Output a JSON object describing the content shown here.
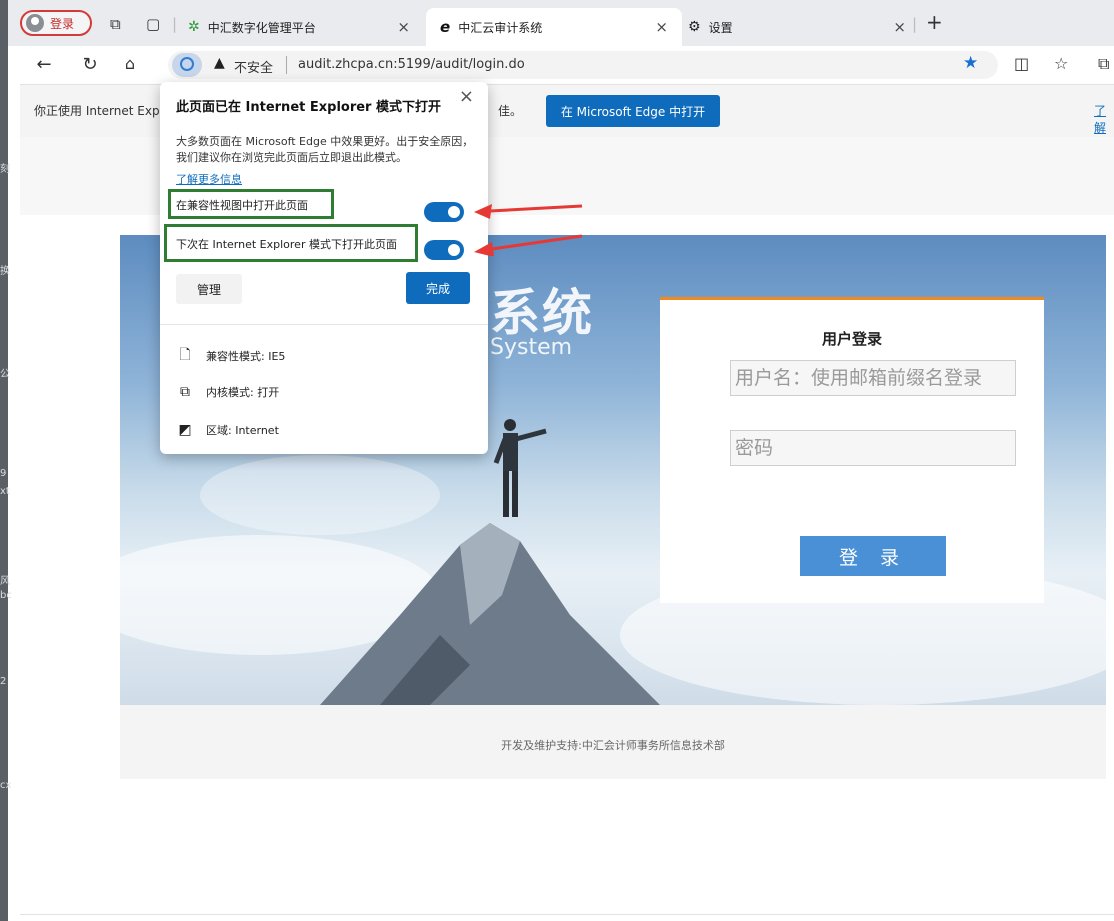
{
  "left_strip_chars": [
    "刻",
    "换",
    "公",
    "9",
    "xt",
    "风",
    "bc",
    "2",
    "cx"
  ],
  "profile": {
    "label": "登录"
  },
  "tabs": [
    {
      "title": "中汇数字化管理平台",
      "icon": "gear-app-icon"
    },
    {
      "title": "中汇云审计系统",
      "icon": "ie-logo-icon",
      "active": true
    },
    {
      "title": "设置",
      "icon": "settings-gear-icon"
    }
  ],
  "tab_close": "×",
  "new_tab": "+",
  "address": {
    "security": "不安全",
    "url": "audit.zhcpa.cn:5199/audit/login.do"
  },
  "infobar": {
    "text": "你正使用 Internet Exp",
    "suffix": "佳。",
    "open_button": "在 Microsoft Edge 中打开",
    "learn_more": "了解"
  },
  "popup": {
    "title": "此页面已在 Internet Explorer 模式下打开",
    "close": "×",
    "description": "大多数页面在 Microsoft Edge 中效果更好。出于安全原因，我们建议你在浏览完此页面后立即退出此模式。",
    "link": "了解更多信息",
    "toggle1_label": "在兼容性视图中打开此页面",
    "toggle2_label": "下次在 Internet Explorer 模式下打开此页面",
    "manage": "管理",
    "done": "完成",
    "info_rows": [
      {
        "icon": "document-icon",
        "text": "兼容性模式: IE5"
      },
      {
        "icon": "engine-icon",
        "text": "内核模式: 打开"
      },
      {
        "icon": "zone-icon",
        "text": "区域: Internet"
      }
    ]
  },
  "hero": {
    "title": "系统",
    "subtitle": "System"
  },
  "login": {
    "title": "用户登录",
    "username_placeholder": "用户名：使用邮箱前缀名登录",
    "password_placeholder": "密码",
    "submit": "登 录"
  },
  "footer": "开发及维护支持:中汇会计师事务所信息技术部",
  "colors": {
    "accent": "#0f6cbd",
    "highlight_box": "#2e7d32",
    "arrow": "#e53935",
    "card_top": "#f08a1e"
  }
}
